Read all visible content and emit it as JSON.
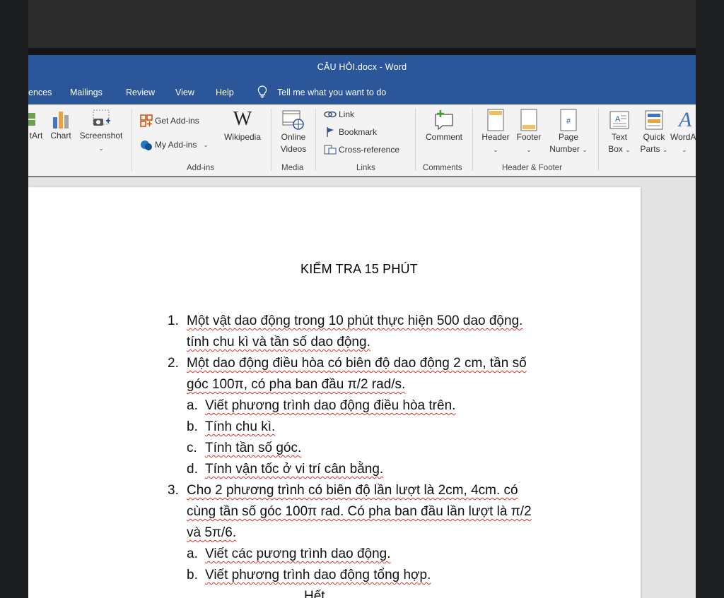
{
  "window": {
    "title": "CÂU HỎI.docx  -  Word"
  },
  "tabs": [
    {
      "label": "ences"
    },
    {
      "label": "Mailings"
    },
    {
      "label": "Review"
    },
    {
      "label": "View"
    },
    {
      "label": "Help"
    }
  ],
  "tell_me": {
    "label": "Tell me what you want to do"
  },
  "ribbon": {
    "smartart": "tArt",
    "chart": "Chart",
    "screenshot": "Screenshot",
    "get_addins": "Get Add-ins",
    "my_addins": "My Add-ins",
    "wikipedia": "Wikipedia",
    "online_videos": [
      "Online",
      "Videos"
    ],
    "link": "Link",
    "bookmark": "Bookmark",
    "cross_reference": "Cross-reference",
    "comment": "Comment",
    "header": "Header",
    "footer": "Footer",
    "page_number": [
      "Page",
      "Number"
    ],
    "text_box": [
      "Text",
      "Box"
    ],
    "quick_parts": [
      "Quick",
      "Parts"
    ],
    "wordart": "WordA",
    "groups": {
      "addins": "Add-ins",
      "media": "Media",
      "links": "Links",
      "comments": "Comments",
      "header_footer": "Header & Footer"
    }
  },
  "document": {
    "title": "KIỂM TRA 15 PHÚT",
    "lines": [
      {
        "marker": "1.",
        "text": "Một vật dao động trong 10 phút thực hiện 500 dao động."
      },
      {
        "marker": "",
        "text": "tính chu kì và tần số dao động."
      },
      {
        "marker": "2.",
        "text": "Một dao động điều hòa có biên độ dao động 2 cm, tần số"
      },
      {
        "marker": "",
        "text": "góc 100π, có pha ban đầu π/2 rad/s."
      },
      {
        "marker": "a.",
        "text": "Viết phương trình dao động điều hòa trên."
      },
      {
        "marker": "b.",
        "text": "Tính chu kì."
      },
      {
        "marker": "c.",
        "text": "Tính tần số góc."
      },
      {
        "marker": "d.",
        "text": "Tính vận tốc ở vi trí cân bằng."
      },
      {
        "marker": "3.",
        "text": "Cho 2 phương trình có biên độ lần lượt là 2cm, 4cm. có"
      },
      {
        "marker": "",
        "text": "cùng tần số góc 100π rad. Có pha ban đầu lần lượt là π/2"
      },
      {
        "marker": "",
        "text": "và 5π/6."
      },
      {
        "marker": "a.",
        "text": "Viết các pương trình dao động."
      },
      {
        "marker": "b.",
        "text": "Viết phương trình dao động tổng hợp."
      }
    ],
    "end": "Hết."
  },
  "colors": {
    "word_blue": "#2b579a",
    "ribbon_bg": "#f3f3f3",
    "spell_squiggle": "#d93025"
  }
}
